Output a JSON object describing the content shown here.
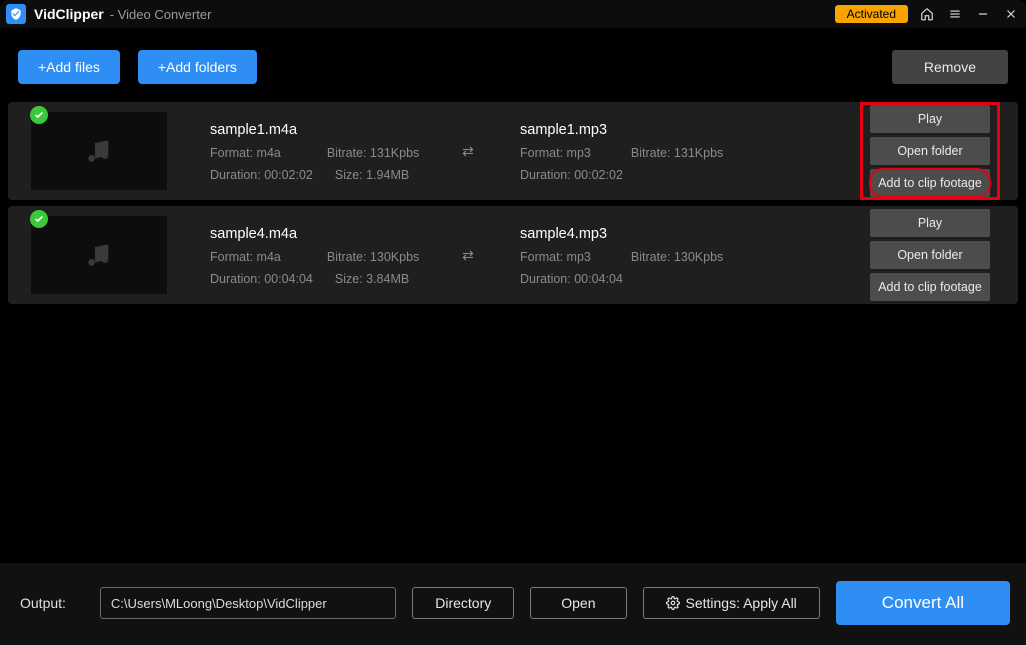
{
  "header": {
    "app_name": "VidClipper",
    "subtitle": "- Video Converter",
    "activated_label": "Activated"
  },
  "toolbar": {
    "add_files": "+Add files",
    "add_folders": "+Add folders",
    "remove": "Remove"
  },
  "actions": {
    "play": "Play",
    "open_folder": "Open folder",
    "add_clip": "Add to clip footage"
  },
  "files": [
    {
      "src_name": "sample1.m4a",
      "src_format": "Format: m4a",
      "src_bitrate": "Bitrate: 131Kpbs",
      "src_duration": "Duration: 00:02:02",
      "src_size": "Size: 1.94MB",
      "dst_name": "sample1.mp3",
      "dst_format": "Format: mp3",
      "dst_bitrate": "Bitrate: 131Kpbs",
      "dst_duration": "Duration: 00:02:02",
      "highlight": true
    },
    {
      "src_name": "sample4.m4a",
      "src_format": "Format: m4a",
      "src_bitrate": "Bitrate: 130Kpbs",
      "src_duration": "Duration: 00:04:04",
      "src_size": "Size: 3.84MB",
      "dst_name": "sample4.mp3",
      "dst_format": "Format: mp3",
      "dst_bitrate": "Bitrate: 130Kpbs",
      "dst_duration": "Duration: 00:04:04",
      "highlight": false
    }
  ],
  "bottom": {
    "output_label": "Output:",
    "output_path": "C:\\Users\\MLoong\\Desktop\\VidClipper",
    "directory": "Directory",
    "open": "Open",
    "settings": "Settings: Apply All",
    "convert": "Convert All"
  }
}
